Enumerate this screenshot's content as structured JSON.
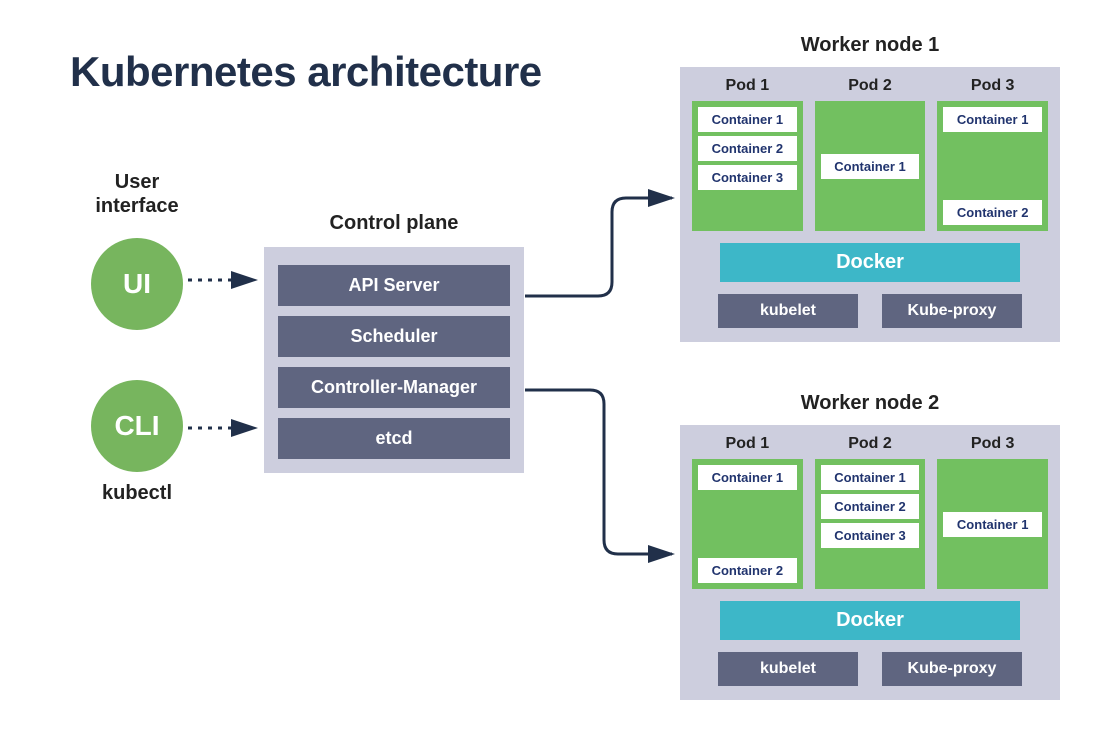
{
  "title": "Kubernetes architecture",
  "user_interface": {
    "heading": "User\ninterface",
    "ui_label": "UI",
    "cli_label": "CLI",
    "kubectl": "kubectl"
  },
  "control_plane": {
    "heading": "Control plane",
    "items": [
      "API Server",
      "Scheduler",
      "Controller-Manager",
      "etcd"
    ]
  },
  "workers": [
    {
      "heading": "Worker node 1",
      "pods": [
        {
          "label": "Pod 1",
          "containers": [
            "Container 1",
            "Container 2",
            "Container 3"
          ],
          "layout": "top"
        },
        {
          "label": "Pod 2",
          "containers": [
            "Container 1"
          ],
          "layout": "middle"
        },
        {
          "label": "Pod 3",
          "containers": [
            "Container 1",
            "Container 2"
          ],
          "layout": "split"
        }
      ],
      "docker": "Docker",
      "kubelet": "kubelet",
      "kubeproxy": "Kube-proxy"
    },
    {
      "heading": "Worker node 2",
      "pods": [
        {
          "label": "Pod 1",
          "containers": [
            "Container 1",
            "Container 2"
          ],
          "layout": "split"
        },
        {
          "label": "Pod 2",
          "containers": [
            "Container 1",
            "Container 2",
            "Container 3"
          ],
          "layout": "top"
        },
        {
          "label": "Pod 3",
          "containers": [
            "Container 1"
          ],
          "layout": "middle"
        }
      ],
      "docker": "Docker",
      "kubelet": "kubelet",
      "kubeproxy": "Kube-proxy"
    }
  ]
}
